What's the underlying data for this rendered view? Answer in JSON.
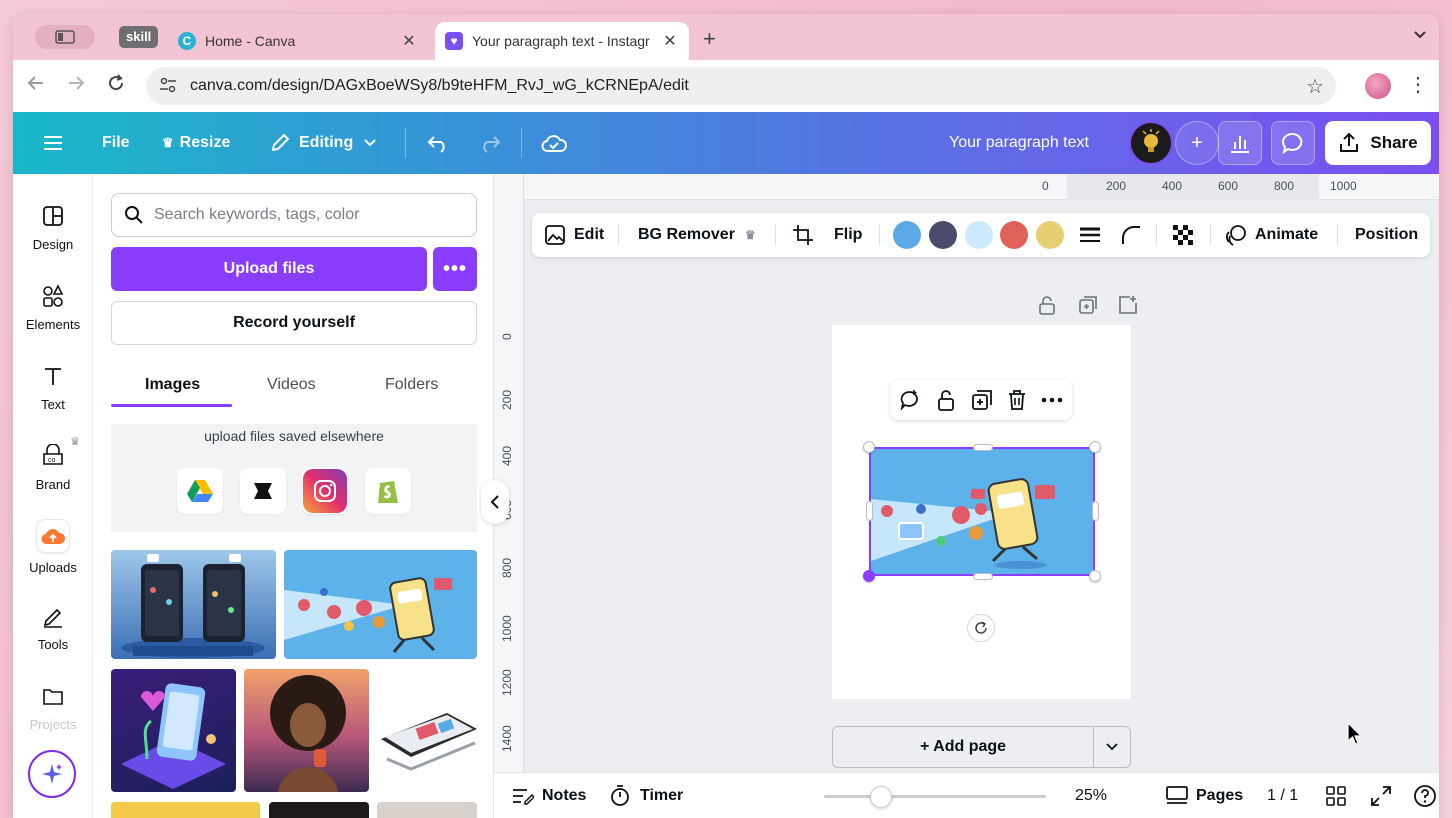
{
  "browser": {
    "skill_badge": "skill",
    "tabs": [
      {
        "title": "Home - Canva",
        "close": "✕"
      },
      {
        "title": "Your paragraph text - Instagr",
        "close": "✕"
      }
    ],
    "new_tab": "+",
    "url": "canva.com/design/DAGxBoeWSy8/b9teHFM_RvJ_wG_kCRNEpA/edit"
  },
  "header": {
    "file": "File",
    "resize": "Resize",
    "editing": "Editing",
    "design_title": "Your paragraph text",
    "share": "Share"
  },
  "rail": {
    "items": [
      {
        "label": "Design",
        "icon": "design-icon"
      },
      {
        "label": "Elements",
        "icon": "elements-icon"
      },
      {
        "label": "Text",
        "icon": "text-icon"
      },
      {
        "label": "Brand",
        "icon": "brand-icon"
      },
      {
        "label": "Uploads",
        "icon": "uploads-icon"
      },
      {
        "label": "Tools",
        "icon": "tools-icon"
      },
      {
        "label": "Projects",
        "icon": "projects-icon"
      }
    ]
  },
  "panel": {
    "search_placeholder": "Search keywords, tags, color",
    "upload_files": "Upload files",
    "more": "•••",
    "record_yourself": "Record yourself",
    "tabs": [
      "Images",
      "Videos",
      "Folders"
    ],
    "elsewhere_text": "upload files saved elsewhere",
    "services": [
      "Google Drive",
      "Dropbox",
      "Instagram",
      "Shopify"
    ]
  },
  "ruler": {
    "top": [
      "0",
      "200",
      "400",
      "600",
      "800",
      "1000"
    ],
    "left": [
      "0",
      "200",
      "400",
      "600",
      "800",
      "1000",
      "1200",
      "1400"
    ]
  },
  "context_toolbar": {
    "edit": "Edit",
    "bg_remover": "BG Remover",
    "flip": "Flip",
    "animate": "Animate",
    "position": "Position",
    "colors": [
      "#5aa9e6",
      "#4a4a6a",
      "#cdeafc",
      "#e0615a",
      "#e6cf72"
    ]
  },
  "canvas": {
    "add_page": "+ Add page"
  },
  "footer": {
    "notes": "Notes",
    "timer": "Timer",
    "zoom": "25%",
    "zoom_level": 0.25,
    "pages": "Pages",
    "page_count": "1 / 1"
  }
}
